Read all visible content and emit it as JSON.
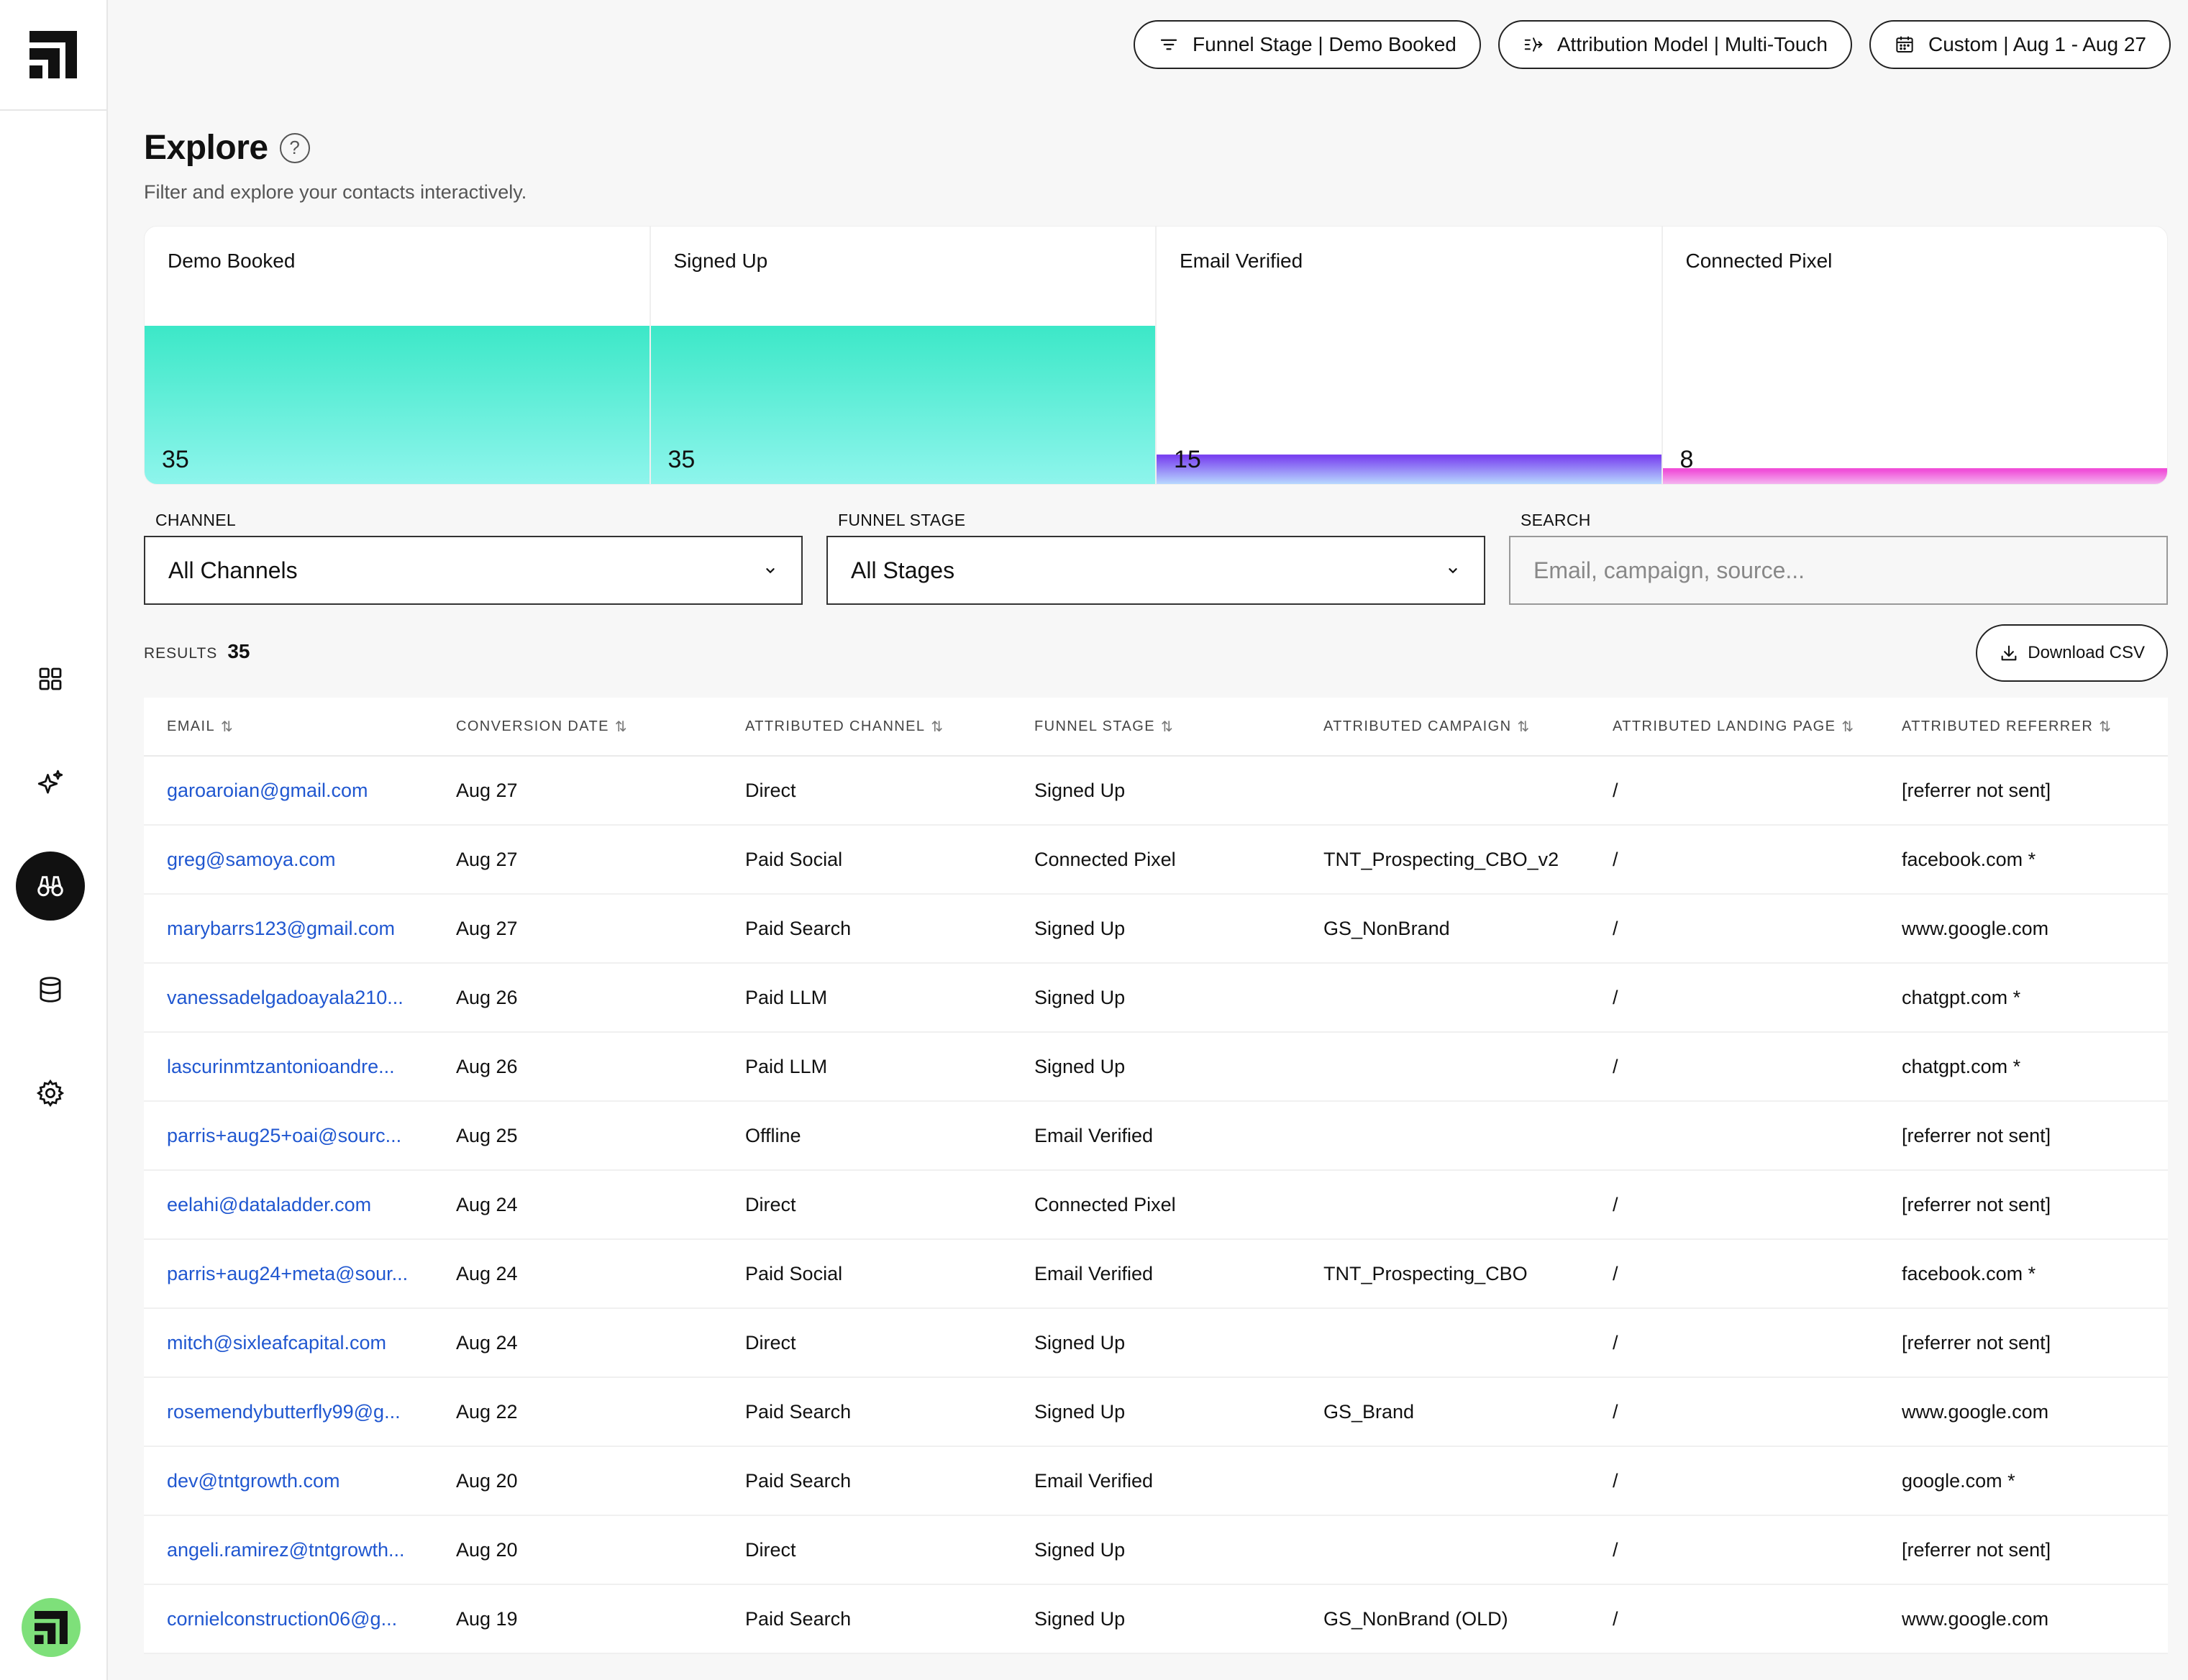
{
  "header": {
    "pills": [
      {
        "label": "Funnel Stage | Demo Booked",
        "icon": "filter-icon"
      },
      {
        "label": "Attribution Model | Multi-Touch",
        "icon": "attribution-icon"
      },
      {
        "label": "Custom | Aug 1 - Aug 27",
        "icon": "calendar-icon"
      }
    ]
  },
  "page": {
    "title": "Explore",
    "help": "?",
    "subtitle": "Filter and explore your contacts interactively."
  },
  "funnel": [
    {
      "label": "Demo Booked",
      "count": "35",
      "value": 35
    },
    {
      "label": "Signed Up",
      "count": "35",
      "value": 35
    },
    {
      "label": "Email Verified",
      "count": "15",
      "value": 15
    },
    {
      "label": "Connected Pixel",
      "count": "8",
      "value": 8
    }
  ],
  "filters": {
    "channel_label": "CHANNEL",
    "channel_value": "All Channels",
    "stage_label": "FUNNEL STAGE",
    "stage_value": "All Stages",
    "search_label": "SEARCH",
    "search_placeholder": "Email, campaign, source..."
  },
  "results": {
    "label": "RESULTS",
    "count": "35"
  },
  "download_label": "Download CSV",
  "colors": {
    "teal_top": "#3de8c8",
    "teal_bottom": "#8ef5ec",
    "purple_top": "#7a44f0",
    "purple_bottom": "#b7d8ff",
    "pink_top": "#f04fd8",
    "pink_bottom": "#f4b4f0",
    "link": "#2057d0"
  },
  "table": {
    "columns": [
      "EMAIL",
      "CONVERSION DATE",
      "ATTRIBUTED CHANNEL",
      "FUNNEL STAGE",
      "ATTRIBUTED CAMPAIGN",
      "ATTRIBUTED LANDING PAGE",
      "ATTRIBUTED REFERRER"
    ],
    "rows": [
      [
        "garoaroian@gmail.com",
        "Aug 27",
        "Direct",
        "Signed Up",
        "",
        "/",
        "[referrer not sent]"
      ],
      [
        "greg@samoya.com",
        "Aug 27",
        "Paid Social",
        "Connected Pixel",
        "TNT_Prospecting_CBO_v2",
        "/",
        "facebook.com *"
      ],
      [
        "marybarrs123@gmail.com",
        "Aug 27",
        "Paid Search",
        "Signed Up",
        "GS_NonBrand",
        "/",
        "www.google.com"
      ],
      [
        "vanessadelgadoayala210...",
        "Aug 26",
        "Paid LLM",
        "Signed Up",
        "",
        "/",
        "chatgpt.com *"
      ],
      [
        "lascurinmtzantonioandre...",
        "Aug 26",
        "Paid LLM",
        "Signed Up",
        "",
        "/",
        "chatgpt.com *"
      ],
      [
        "parris+aug25+oai@sourc...",
        "Aug 25",
        "Offline",
        "Email Verified",
        "",
        "",
        "[referrer not sent]"
      ],
      [
        "eelahi@dataladder.com",
        "Aug 24",
        "Direct",
        "Connected Pixel",
        "",
        "/",
        "[referrer not sent]"
      ],
      [
        "parris+aug24+meta@sour...",
        "Aug 24",
        "Paid Social",
        "Email Verified",
        "TNT_Prospecting_CBO",
        "/",
        "facebook.com *"
      ],
      [
        "mitch@sixleafcapital.com",
        "Aug 24",
        "Direct",
        "Signed Up",
        "",
        "/",
        "[referrer not sent]"
      ],
      [
        "rosemendybutterfly99@g...",
        "Aug 22",
        "Paid Search",
        "Signed Up",
        "GS_Brand",
        "/",
        "www.google.com"
      ],
      [
        "dev@tntgrowth.com",
        "Aug 20",
        "Paid Search",
        "Email Verified",
        "",
        "/",
        "google.com *"
      ],
      [
        "angeli.ramirez@tntgrowth...",
        "Aug 20",
        "Direct",
        "Signed Up",
        "",
        "/",
        "[referrer not sent]"
      ],
      [
        "cornielconstruction06@g...",
        "Aug 19",
        "Paid Search",
        "Signed Up",
        "GS_NonBrand (OLD)",
        "/",
        "www.google.com"
      ]
    ]
  },
  "sidebar": {
    "items": [
      {
        "name": "dashboard",
        "icon": "grid-icon"
      },
      {
        "name": "ai",
        "icon": "sparkle-icon"
      },
      {
        "name": "explore",
        "icon": "binoculars-icon",
        "active": true
      },
      {
        "name": "data",
        "icon": "database-icon"
      },
      {
        "name": "settings",
        "icon": "gear-icon"
      }
    ]
  }
}
